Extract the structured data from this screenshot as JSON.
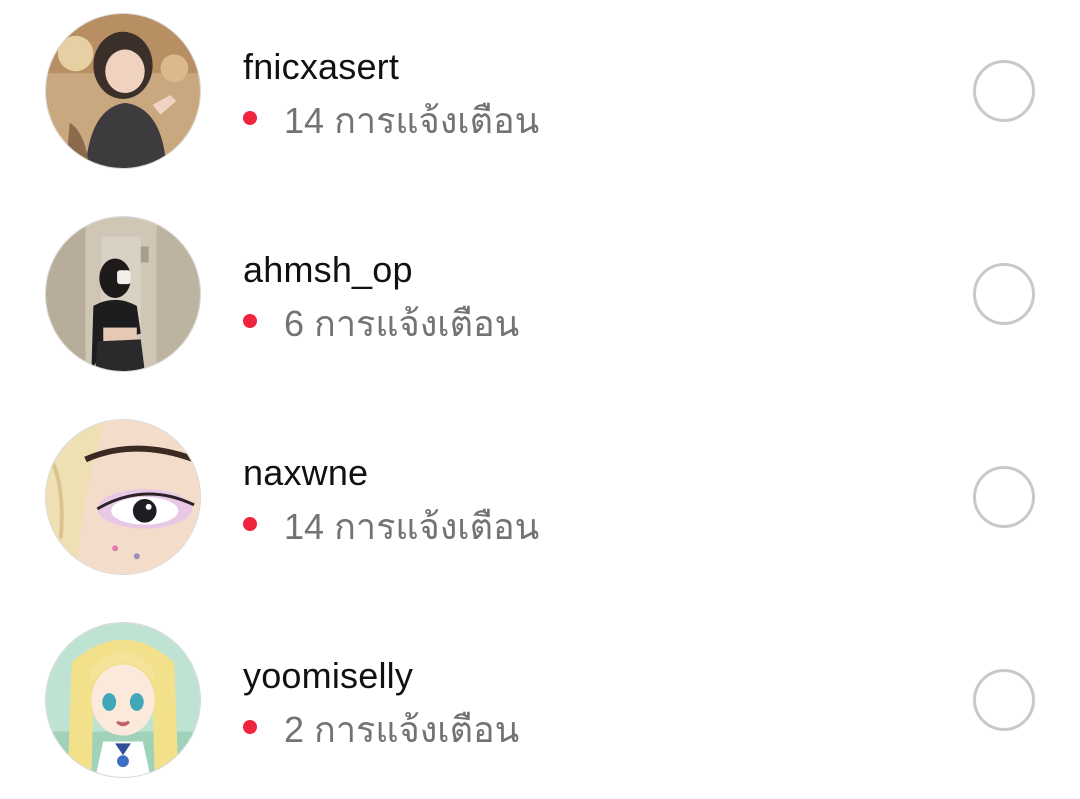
{
  "accounts": [
    {
      "username": "fnicxasert",
      "count": "14",
      "notif_label": "การแจ้งเตือน",
      "avatar_icon": "profile-photo"
    },
    {
      "username": "ahmsh_op",
      "count": "6",
      "notif_label": "การแจ้งเตือน",
      "avatar_icon": "profile-photo"
    },
    {
      "username": "naxwne",
      "count": "14",
      "notif_label": "การแจ้งเตือน",
      "avatar_icon": "profile-illustration"
    },
    {
      "username": "yoomiselly",
      "count": "2",
      "notif_label": "การแจ้งเตือน",
      "avatar_icon": "profile-illustration"
    }
  ],
  "colors": {
    "notification_dot": "#f0243f",
    "username_text": "#111111",
    "secondary_text": "#737373",
    "radio_border": "#c9c9c9"
  }
}
